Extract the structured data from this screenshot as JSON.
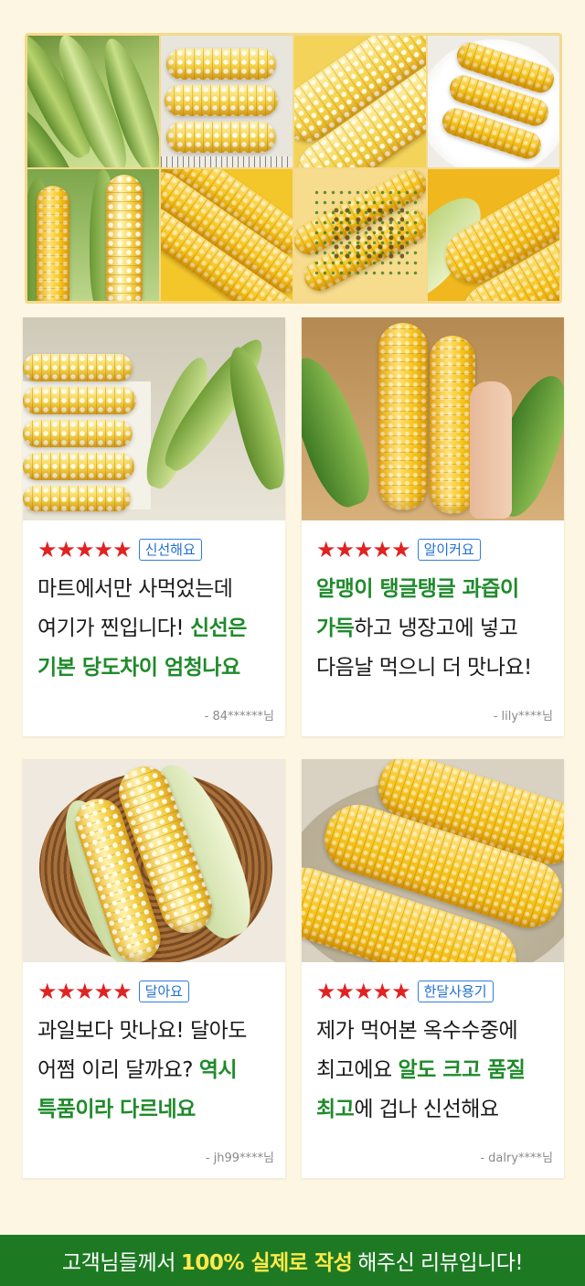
{
  "gallery": {
    "photos": [
      "corn-in-husk-photo",
      "bicolor-corn-on-ruler-photo",
      "bicolor-corn-kernels-closeup-photo",
      "corn-on-plate-photo",
      "corn-with-husk-closeup-photo",
      "yellow-corn-pile-photo",
      "grilled-corn-with-herbs-photo",
      "yellow-corn-kernels-closeup-photo"
    ]
  },
  "reviews": [
    {
      "rating": "★★★★★",
      "tag": "신선해요",
      "text_parts": [
        {
          "t": "마트에서만 사먹었는데 여기가 찐입니다! ",
          "hl": false
        },
        {
          "t": "신선은 기본 당도차이 엄청나요",
          "hl": true
        }
      ],
      "author": "- 84******님"
    },
    {
      "rating": "★★★★★",
      "tag": "알이커요",
      "text_parts": [
        {
          "t": "알맹이 탱글탱글 과즙이 가득",
          "hl": true
        },
        {
          "t": "하고 냉장고에 넣고 다음날 먹으니 더 맛나요!",
          "hl": false
        }
      ],
      "author": "- lily****님"
    },
    {
      "rating": "★★★★★",
      "tag": "달아요",
      "text_parts": [
        {
          "t": "과일보다 맛나요! 달아도 어쩜 이리 달까요? ",
          "hl": false
        },
        {
          "t": "역시 특품이라 다르네요",
          "hl": true
        }
      ],
      "author": "- jh99****님"
    },
    {
      "rating": "★★★★★",
      "tag": "한달사용기",
      "text_parts": [
        {
          "t": "제가 먹어본 옥수수중에 최고에요 ",
          "hl": false
        },
        {
          "t": "알도 크고 품질 최고",
          "hl": true
        },
        {
          "t": "에 겁나 신선해요",
          "hl": false
        }
      ],
      "author": "- dalry****님"
    }
  ],
  "footer": {
    "prefix": "고객님들께서",
    "highlight": "100% 실제로 작성",
    "suffix": "해주신 리뷰입니다!"
  },
  "colors": {
    "background": "#fdf6e3",
    "star": "#e02222",
    "tag_border": "#2f7de0",
    "highlight_text": "#1f8a2b",
    "footer_bg": "#1d7a23",
    "footer_highlight": "#ffe94a"
  }
}
